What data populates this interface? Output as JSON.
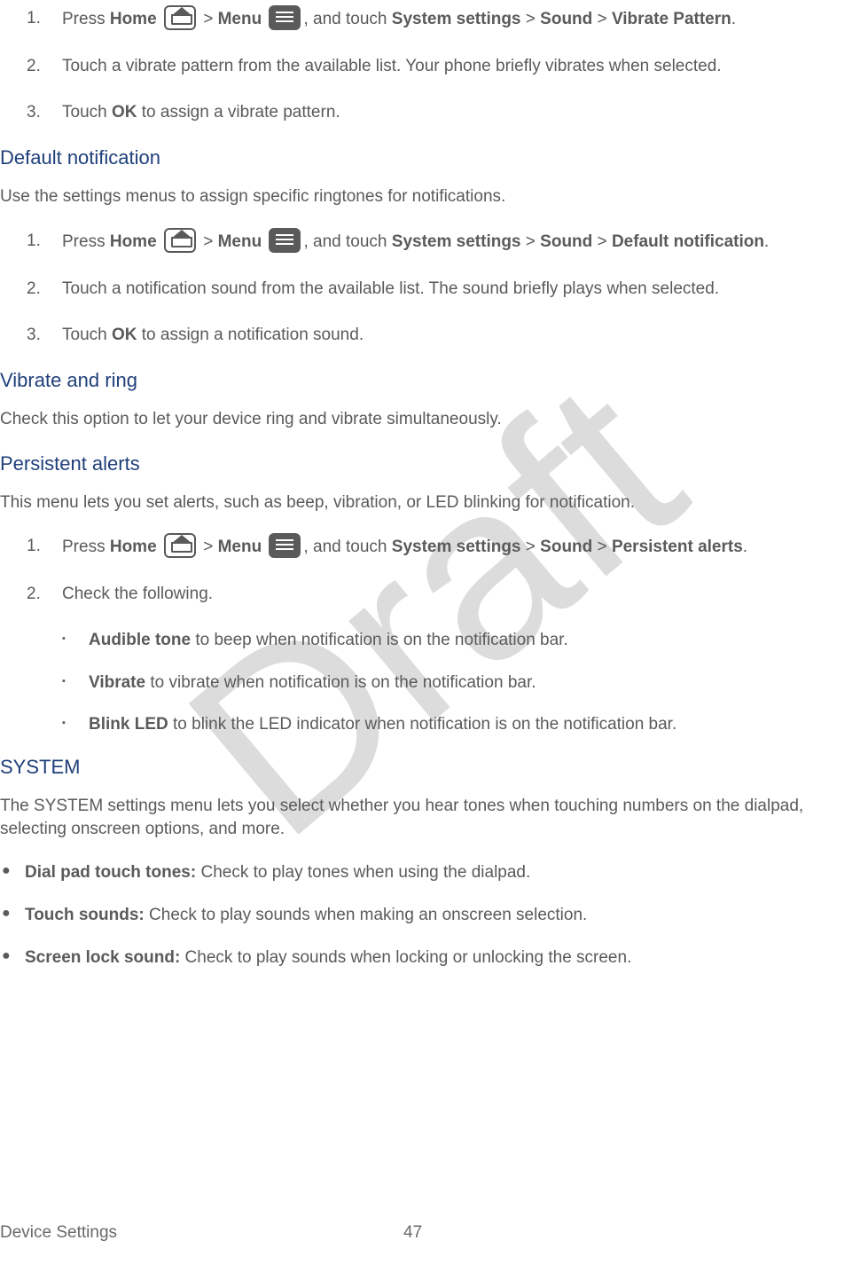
{
  "watermark": "Draft",
  "list1": {
    "item1": {
      "num": "1.",
      "press": "Press ",
      "home": "Home",
      "gt1": " > ",
      "menu": "Menu",
      "tail": ", and touch ",
      "sys": "System settings",
      "gt2": " > ",
      "sound": "Sound",
      "gt3": " > ",
      "target": "Vibrate Pattern",
      "period": "."
    },
    "item2": {
      "num": "2.",
      "text": "Touch a vibrate pattern from the available list. Your phone briefly vibrates when selected."
    },
    "item3": {
      "num": "3.",
      "pre": "Touch ",
      "ok": "OK",
      "post": " to assign a vibrate pattern."
    }
  },
  "h1": "Default notification",
  "p1": "Use the settings menus to assign specific ringtones for notifications.",
  "list2": {
    "item1": {
      "num": "1.",
      "press": "Press ",
      "home": "Home",
      "gt1": " > ",
      "menu": "Menu",
      "tail": ", and touch ",
      "sys": "System settings",
      "gt2": " > ",
      "sound": "Sound",
      "gt3": " > ",
      "target": "Default notification",
      "period": "."
    },
    "item2": {
      "num": "2.",
      "text": "Touch a notification sound from the available list. The sound briefly plays when selected."
    },
    "item3": {
      "num": "3.",
      "pre": "Touch ",
      "ok": "OK",
      "post": " to assign a notification sound."
    }
  },
  "h2": "Vibrate and ring",
  "p2": "Check this option to let your device ring and vibrate simultaneously.",
  "h3": "Persistent alerts",
  "p3": "This menu lets you set alerts, such as beep, vibration, or LED blinking for notification.",
  "list3": {
    "item1": {
      "num": "1.",
      "press": "Press ",
      "home": "Home",
      "gt1": " > ",
      "menu": "Menu",
      "tail": ", and touch ",
      "sys": "System settings",
      "gt2": " > ",
      "sound": "Sound",
      "gt3": " > ",
      "target": "Persistent alerts",
      "period": "."
    },
    "item2": {
      "num": "2.",
      "text": "Check the following."
    }
  },
  "sublist": {
    "s1": {
      "bold": "Audible tone",
      "text": " to beep when notification is on the notification bar."
    },
    "s2": {
      "bold": "Vibrate",
      "text": " to vibrate when notification is on the notification bar."
    },
    "s3": {
      "bold": "Blink LED",
      "text": " to blink the LED indicator when notification is on the notification bar."
    }
  },
  "h4": "SYSTEM",
  "p4": "The SYSTEM settings menu lets you select whether you hear tones when touching numbers on the dialpad, selecting onscreen options, and more.",
  "dotlist": {
    "d1": {
      "bold": "Dial pad touch tones:",
      "text": " Check to play tones when using the dialpad."
    },
    "d2": {
      "bold": "Touch sounds:",
      "text": " Check to play sounds when making an onscreen selection."
    },
    "d3": {
      "bold": "Screen lock sound:",
      "text": " Check to play sounds when locking or unlocking the screen."
    }
  },
  "footer": {
    "section": "Device Settings",
    "page": "47"
  }
}
